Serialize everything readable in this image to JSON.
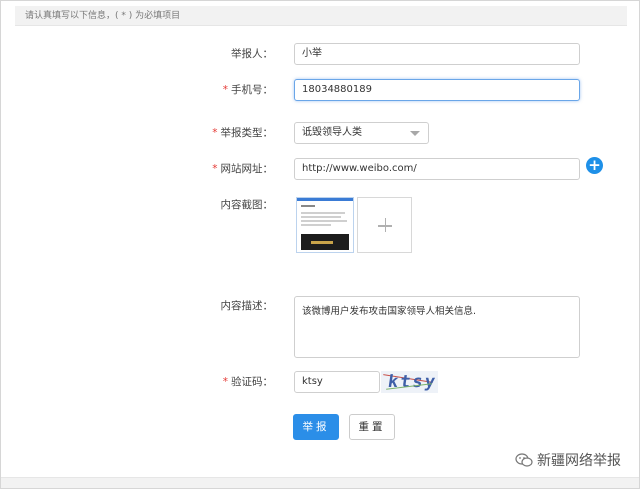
{
  "notice": "请认真填写以下信息，( * ) 为必填项目",
  "form": {
    "reporter": {
      "label": "举报人：",
      "required": false,
      "value": "小举"
    },
    "phone": {
      "label": "手机号：",
      "required": true,
      "value": "18034880189"
    },
    "report_type": {
      "label": "举报类型：",
      "required": true,
      "value": "诋毁领导人类"
    },
    "website": {
      "label": "网站网址：",
      "required": true,
      "value": "http://www.weibo.com/"
    },
    "screenshot": {
      "label": "内容截图：",
      "required": false
    },
    "description": {
      "label": "内容描述：",
      "required": false,
      "value": "该微博用户发布攻击国家领导人相关信息."
    },
    "captcha": {
      "label": "验证码：",
      "required": true,
      "value": "ktsy",
      "image_text": "ktsy"
    }
  },
  "required_mark": "*",
  "buttons": {
    "submit": "举报",
    "reset": "重置"
  },
  "watermark": "新疆网络举报",
  "colors": {
    "accent": "#2b8ee8",
    "required": "#e53a35"
  }
}
